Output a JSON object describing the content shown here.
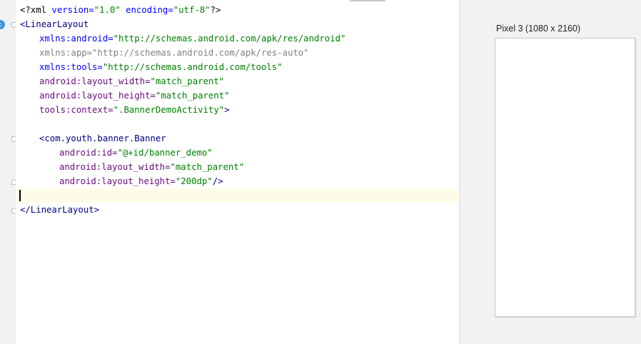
{
  "editor": {
    "lines": {
      "xml_decl": {
        "open": "<?xml ",
        "v_attr": "version=",
        "v_val": "\"1.0\"",
        "e_attr": " encoding=",
        "e_val": "\"utf-8\"",
        "close": "?>"
      },
      "ll_open": "<LinearLayout",
      "ns_android": {
        "attr": "xmlns:android=",
        "val": "\"http://schemas.android.com/apk/res/android\""
      },
      "ns_app": {
        "attr": "xmlns:app=",
        "val": "\"http://schemas.android.com/apk/res-auto\""
      },
      "ns_tools": {
        "attr": "xmlns:tools=",
        "val": "\"http://schemas.android.com/tools\""
      },
      "lw": {
        "attr": "android:layout_width=",
        "val": "\"match_parent\""
      },
      "lh": {
        "attr": "android:layout_height=",
        "val": "\"match_parent\""
      },
      "ctx": {
        "attr": "tools:context=",
        "val": "\".BannerDemoActivity\"",
        "close": ">"
      },
      "banner_open": "<com.youth.banner.Banner",
      "b_id": {
        "attr": "android:id=",
        "val": "\"@+id/banner_demo\""
      },
      "b_lw": {
        "attr": "android:layout_width=",
        "val": "\"match_parent\""
      },
      "b_lh": {
        "attr": "android:layout_height=",
        "val": "\"200dp\"",
        "close": "/>"
      },
      "ll_close": "</LinearLayout>"
    },
    "gutter_badge": "c"
  },
  "preview": {
    "device_label": "Pixel 3 (1080 x 2160)"
  },
  "icons": {
    "gutter_badge": "class-icon",
    "fold": "fold-marker-icon"
  }
}
